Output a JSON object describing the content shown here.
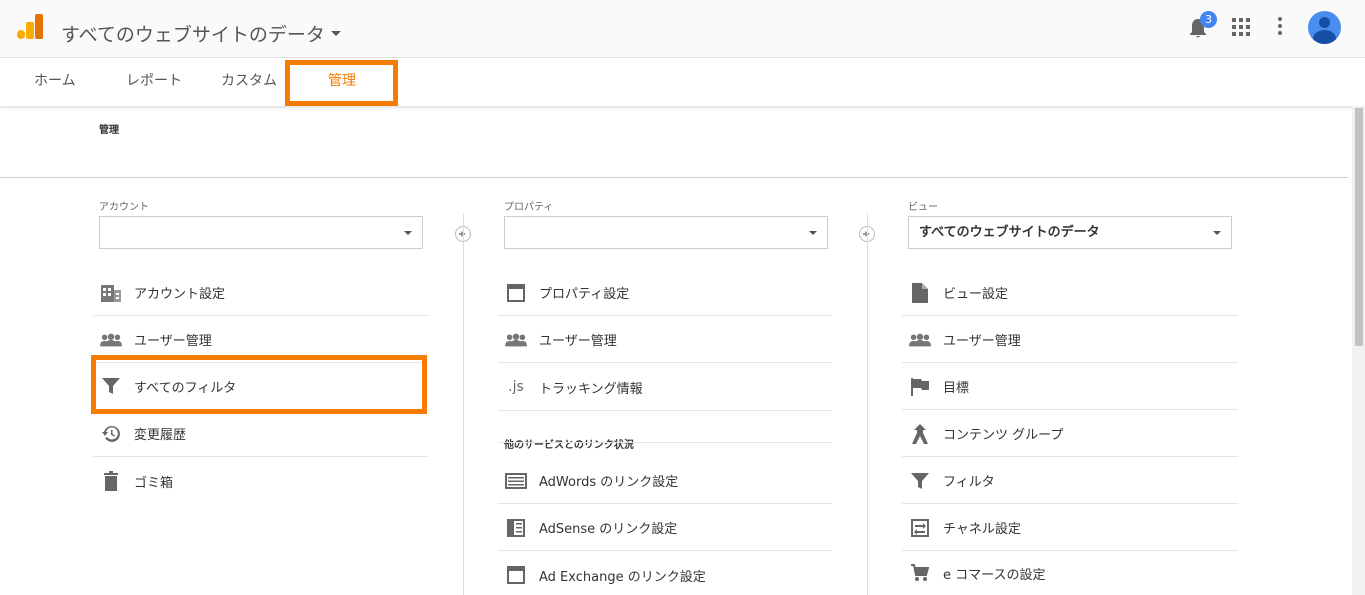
{
  "header": {
    "title": "すべてのウェブサイトのデータ",
    "notification_count": "3",
    "accent_color": "#f57c00"
  },
  "tabs": [
    {
      "label": "ホーム"
    },
    {
      "label": "レポート"
    },
    {
      "label": "カスタム"
    },
    {
      "label": "管理",
      "active": true
    }
  ],
  "page": {
    "section_title": "管理"
  },
  "account": {
    "label": "アカウント",
    "selected": "",
    "items": [
      {
        "label": "アカウント設定",
        "icon": "building-icon"
      },
      {
        "label": "ユーザー管理",
        "icon": "people-icon"
      },
      {
        "label": "すべてのフィルタ",
        "icon": "filter-icon"
      },
      {
        "label": "変更履歴",
        "icon": "history-icon"
      },
      {
        "label": "ゴミ箱",
        "icon": "trash-icon"
      }
    ]
  },
  "property": {
    "label": "プロパティ",
    "selected": "",
    "items": [
      {
        "label": "プロパティ設定",
        "icon": "window-icon"
      },
      {
        "label": "ユーザー管理",
        "icon": "people-icon"
      },
      {
        "label": "トラッキング情報",
        "icon": "js-icon"
      }
    ],
    "links_heading": "他のサービスとのリンク状況",
    "links": [
      {
        "label": "AdWords のリンク設定",
        "icon": "adwords-icon"
      },
      {
        "label": "AdSense のリンク設定",
        "icon": "adsense-icon"
      },
      {
        "label": "Ad Exchange のリンク設定",
        "icon": "adexchange-icon"
      }
    ]
  },
  "view": {
    "label": "ビュー",
    "selected": "すべてのウェブサイトのデータ",
    "items": [
      {
        "label": "ビュー設定",
        "icon": "document-icon"
      },
      {
        "label": "ユーザー管理",
        "icon": "people-icon"
      },
      {
        "label": "目標",
        "icon": "flag-icon"
      },
      {
        "label": "コンテンツ グループ",
        "icon": "content-group-icon"
      },
      {
        "label": "フィルタ",
        "icon": "filter-icon"
      },
      {
        "label": "チャネル設定",
        "icon": "channel-icon"
      },
      {
        "label": "e コマースの設定",
        "icon": "cart-icon"
      }
    ]
  }
}
